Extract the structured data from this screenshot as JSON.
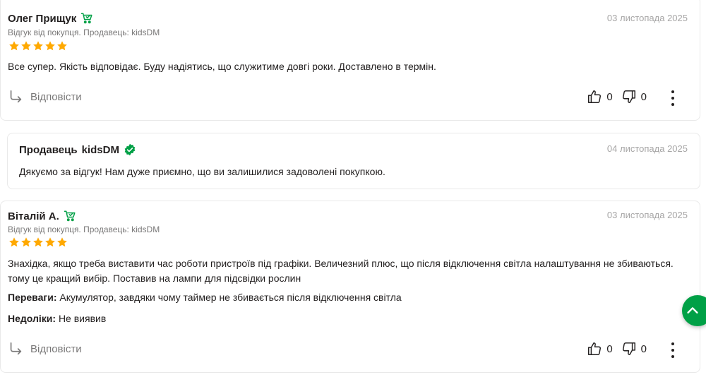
{
  "reviews": [
    {
      "author": "Олег Прищук",
      "date": "03 листопада 2025",
      "meta": "Відгук від покупця. Продавець: kidsDM",
      "rating": 5,
      "text": "Все супер. Якість відповідає. Буду надіятись, що служитиме довгі роки. Доставлено в термін.",
      "reply_label": "Відповісти",
      "likes": "0",
      "dislikes": "0"
    },
    {
      "author": "Віталій А.",
      "date": "03 листопада 2025",
      "meta": "Відгук від покупця. Продавець: kidsDM",
      "rating": 5,
      "text": "Знахідка, якщо треба виставити час роботи пристроїв під графіки. Величезний плюс, що після відключення світла налаштування не збиваються. тому це кращий вибір. Поставив на лампи для підсвідки рослин",
      "pros_label": "Переваги:",
      "pros": "Акумулятор, завдяки чому таймер не збивається після відключення світла",
      "cons_label": "Недоліки:",
      "cons": "Не виявив",
      "reply_label": "Відповісти",
      "likes": "0",
      "dislikes": "0"
    }
  ],
  "seller_reply": {
    "author_prefix": "Продавець",
    "author": "kidsDM",
    "date": "04 листопада 2025",
    "text": "Дякуємо за відгук! Нам дуже приємно, що ви залишилися задоволені покупкою."
  },
  "colors": {
    "star": "#ffa900",
    "green": "#00a046",
    "muted": "#797878",
    "date": "#a6a5a5"
  },
  "icons": {
    "buyer_badge": "cart-check-icon",
    "verified_badge": "verified-icon",
    "reply": "reply-arrow-icon",
    "like": "thumbs-up-icon",
    "dislike": "thumbs-down-icon",
    "more": "more-vertical-icon",
    "fab": "chevron-up-icon"
  }
}
